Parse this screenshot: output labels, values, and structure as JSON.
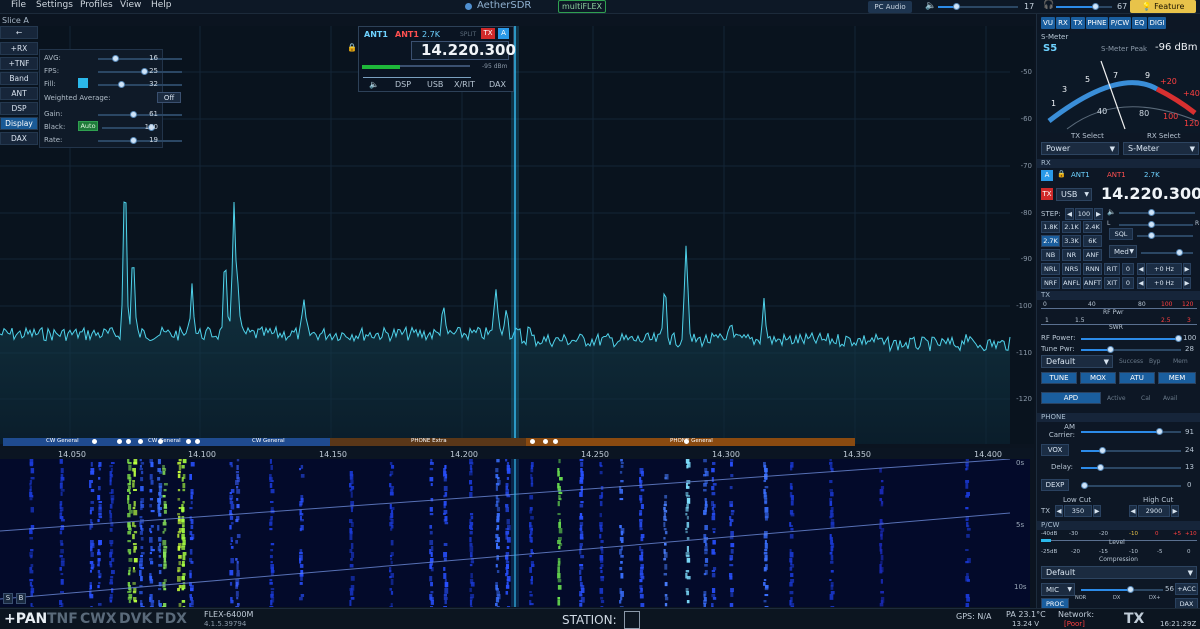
{
  "menu": [
    "File",
    "Settings",
    "Profiles",
    "View",
    "Help"
  ],
  "app_title": "AetherSDR",
  "multiflex": "multiFLEX",
  "pc_audio": "PC Audio",
  "volume_value": "17",
  "headphone_value": "67",
  "feature_request": "Feature Request",
  "slice_label": "Slice A",
  "left_buttons": [
    "←",
    "+RX",
    "+TNF",
    "Band",
    "ANT",
    "DSP",
    "Display",
    "DAX"
  ],
  "display_panel": {
    "avg_label": "AVG:",
    "avg": "16",
    "fps_label": "FPS:",
    "fps": "25",
    "fill_label": "Fill:",
    "fill": "32",
    "weighted_label": "Weighted Average:",
    "weighted_btn": "Off",
    "gain_label": "Gain:",
    "gain": "61",
    "black_label": "Black:",
    "black_btn": "Auto",
    "black": "100",
    "rate_label": "Rate:",
    "rate": "19"
  },
  "vfo": {
    "ant1": "ANT1",
    "ant2": "ANT1",
    "bw": "2.7K",
    "split": "SPLIT",
    "tx": "TX",
    "slice": "A",
    "freq": "14.220.300",
    "dbm": "-95 dBm",
    "tabs": [
      "DSP",
      "USB",
      "X/RIT",
      "DAX"
    ]
  },
  "db_ticks": [
    "-50",
    "-60",
    "-70",
    "-80",
    "-90",
    "-100",
    "-110",
    "-120"
  ],
  "freq_ticks": [
    "14.050",
    "14.100",
    "14.150",
    "14.200",
    "14.250",
    "14.300",
    "14.350",
    "14.400"
  ],
  "band_segments": [
    {
      "label": "CW General",
      "color": "#1f4b8f"
    },
    {
      "label": "CW General",
      "color": "#1f4b8f"
    },
    {
      "label": "CW General",
      "color": "#1f4b8f"
    },
    {
      "label": "PHONE Extra",
      "color": "#6a3f1a"
    },
    {
      "label": "PHONE General",
      "color": "#8a4a10"
    }
  ],
  "waterfall_times": [
    "0s",
    "5s",
    "10s"
  ],
  "bottom": {
    "modes": [
      "+PAN",
      "TNF",
      "CWX",
      "DVK",
      "FDX"
    ],
    "radio": "FLEX-6400M",
    "version": "4.1.5.39794",
    "station_label": "STATION:",
    "gps": "GPS: N/A",
    "pa": "PA 23.1°C",
    "volts": "13.24 V",
    "network_label": "Network:",
    "network_value": "[Poor]",
    "tx": "TX",
    "time": "16:21:29Z"
  },
  "right": {
    "tabs": [
      "VU",
      "RX",
      "TX",
      "PHNE",
      "P/CW",
      "EQ",
      "DIGI"
    ],
    "smeter_title": "S-Meter",
    "s_unit": "S5",
    "peak_label": "S-Meter Peak",
    "peak_value": "-96 dBm",
    "scale_white": [
      "1",
      "3",
      "5",
      "7",
      "9"
    ],
    "scale_red": [
      "+20",
      "+40"
    ],
    "scale_inner": [
      "40",
      "80",
      "100",
      "120"
    ],
    "tx_select_label": "TX Select",
    "rx_select_label": "RX Select",
    "tx_select": "Power",
    "rx_select": "S-Meter",
    "rx_head": "RX",
    "rx_slice": "A",
    "rx_ant1": "ANT1",
    "rx_ant2": "ANT1",
    "rx_bw": "2.7K",
    "rx_tx": "TX",
    "rx_mode": "USB",
    "rx_freq": "14.220.300",
    "step_label": "STEP:",
    "step_value": "100",
    "filters": [
      "1.8K",
      "2.1K",
      "2.4K",
      "2.7K",
      "3.3K",
      "6K"
    ],
    "sql": "SQL",
    "agc": "Med",
    "row_nb": [
      "NB",
      "NR",
      "ANF"
    ],
    "row_nrl": [
      "NRL",
      "NRS",
      "RNN",
      "RIT",
      "0",
      "+0 Hz"
    ],
    "row_nrf": [
      "NRF",
      "ANFL",
      "ANFT",
      "XIT",
      "0",
      "+0 Hz"
    ],
    "tx_head": "TX",
    "tx_scale": [
      "0",
      "40",
      "80",
      "100",
      "120"
    ],
    "rf_pwr": "RF Pwr",
    "swr_scale": [
      "1",
      "1.5",
      "2.5",
      "3"
    ],
    "swr": "SWR",
    "rf_power_label": "RF Power:",
    "rf_power": "100",
    "tune_pwr_label": "Tune Pwr:",
    "tune_pwr": "28",
    "profile": "Default",
    "atu_status": [
      "Success",
      "Byp",
      "Mem"
    ],
    "tx_buttons": [
      "TUNE",
      "MOX",
      "ATU",
      "MEM"
    ],
    "apd": "APD",
    "apd_status": [
      "Active",
      "Cal",
      "Avail"
    ],
    "phone_head": "PHONE",
    "am_label": "AM Carrier:",
    "am_value": "91",
    "vox": "VOX",
    "vox_value": "24",
    "delay_label": "Delay:",
    "delay_value": "13",
    "dexp": "DEXP",
    "dexp_value": "0",
    "low_cut_label": "Low Cut",
    "high_cut_label": "High Cut",
    "tx_lbl": "TX",
    "low_cut": "350",
    "high_cut": "2900",
    "pcw_head": "P/CW",
    "level_scale": [
      "-40dB",
      "-30",
      "-20",
      "-10",
      "0",
      "+5",
      "+10"
    ],
    "level_label": "Level",
    "comp_scale": [
      "-25dB",
      "-20",
      "-15",
      "-10",
      "-5",
      "0"
    ],
    "comp_label": "Compression",
    "profile2": "Default",
    "mic": "MIC",
    "mic_value": "56",
    "acc": "+ACC",
    "proc": "PROC",
    "proc_scale": [
      "NOR",
      "DX",
      "DX+"
    ],
    "dax": "DAX"
  }
}
